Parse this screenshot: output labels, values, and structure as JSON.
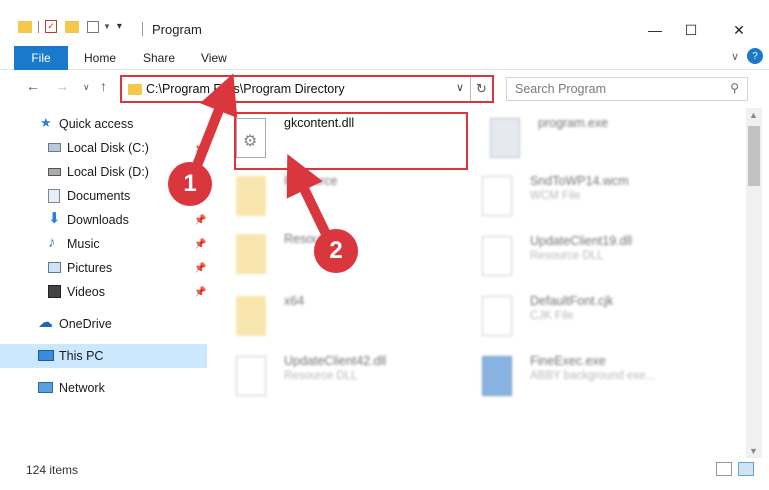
{
  "window": {
    "title": "Program",
    "minimize": "—",
    "maximize": "☐",
    "close": "✕"
  },
  "ribbon": {
    "file": "File",
    "tabs": [
      "Home",
      "Share",
      "View"
    ],
    "help": "?"
  },
  "nav": {
    "address": "C:\\Program Files\\Program Directory",
    "search_placeholder": "Search Program"
  },
  "sidebar": {
    "items": [
      {
        "label": "Quick access",
        "icon": "star-icon"
      },
      {
        "label": "Local Disk (C:)",
        "icon": "drive-icon",
        "pinned": true
      },
      {
        "label": "Local Disk (D:)",
        "icon": "drive-icon",
        "pinned": true
      },
      {
        "label": "Documents",
        "icon": "documents-icon",
        "pinned": true
      },
      {
        "label": "Downloads",
        "icon": "downloads-icon",
        "pinned": true
      },
      {
        "label": "Music",
        "icon": "music-icon",
        "pinned": true
      },
      {
        "label": "Pictures",
        "icon": "pictures-icon",
        "pinned": true
      },
      {
        "label": "Videos",
        "icon": "videos-icon",
        "pinned": true
      },
      {
        "label": "OneDrive",
        "icon": "cloud-icon"
      },
      {
        "label": "This PC",
        "icon": "computer-icon",
        "selected": true
      },
      {
        "label": "Network",
        "icon": "network-icon"
      }
    ]
  },
  "files": [
    {
      "name": "gkcontent.dll",
      "type": "",
      "icon": "dll-gear-icon"
    },
    {
      "name": "program.exe",
      "type": "",
      "icon": "exe-icon"
    },
    {
      "name": "Resource",
      "type": "",
      "icon": "folder-icon"
    },
    {
      "name": "SndToWP14.wcm",
      "type": "WCM File",
      "icon": "file-icon"
    },
    {
      "name": "Resou",
      "type": "",
      "icon": "folder-icon"
    },
    {
      "name": "UpdateClient19.dll",
      "type": "Resource DLL",
      "icon": "dll-gear-icon"
    },
    {
      "name": "x64",
      "type": "",
      "icon": "folder-icon"
    },
    {
      "name": "DefaultFont.cjk",
      "type": "CJK File",
      "icon": "file-icon"
    },
    {
      "name": "UpdateClient42.dll",
      "type": "Resource DLL",
      "icon": "dll-gear-icon"
    },
    {
      "name": "FineExec.exe",
      "type": "ABBY background exe...",
      "icon": "exe-icon"
    }
  ],
  "status": {
    "count": "124 items"
  },
  "annotations": {
    "step1": "1",
    "step2": "2"
  },
  "colors": {
    "accent": "#1979ca",
    "highlight": "#d9363e",
    "selected": "#cce8ff"
  }
}
